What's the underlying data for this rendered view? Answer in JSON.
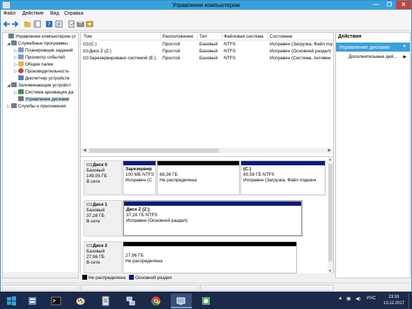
{
  "window": {
    "title": "Управление компьютером",
    "min_label": "—",
    "max_label": "❐",
    "close_label": "✕"
  },
  "menu": [
    "Файл",
    "Действие",
    "Вид",
    "Справка"
  ],
  "tree": [
    {
      "label": "Управление компьютером (л",
      "arrow": "",
      "icon_color": "#6d7c92",
      "selected": false
    },
    {
      "label": "Служебные программы",
      "arrow": "◢",
      "icon_color": "#6d7c92",
      "selected": false
    },
    {
      "label": "Планировщик заданий",
      "arrow": "▷",
      "icon_color": "#7a9bc4",
      "selected": false
    },
    {
      "label": "Просмотр событий",
      "arrow": "▷",
      "icon_color": "#7a9bc4",
      "selected": false
    },
    {
      "label": "Общие папки",
      "arrow": "▷",
      "icon_color": "#e3b84a",
      "selected": false
    },
    {
      "label": "Производительность",
      "arrow": "▷",
      "icon_color": "#c94040",
      "selected": false
    },
    {
      "label": "Диспетчер устройств",
      "arrow": "",
      "icon_color": "#5a7fb0",
      "selected": false
    },
    {
      "label": "Запоминающие устройст",
      "arrow": "◢",
      "icon_color": "#6d7c92",
      "selected": false
    },
    {
      "label": "Система архивации да",
      "arrow": "▷",
      "icon_color": "#3d8f4f",
      "selected": false
    },
    {
      "label": "Управление дисками",
      "arrow": "",
      "icon_color": "#777777",
      "selected": true
    },
    {
      "label": "Службы и приложения",
      "arrow": "▷",
      "icon_color": "#6d7c92",
      "selected": false
    }
  ],
  "volumes": {
    "headers": [
      "Том",
      "Расположение",
      "Тип",
      "Файловая система",
      "Состояние"
    ],
    "rows": [
      [
        "(C:)",
        "Простой",
        "Базовый",
        "NTFS",
        "Исправен (Загрузка, Файл подк"
      ],
      [
        "Диск Z (Z:)",
        "Простой",
        "Базовый",
        "NTFS",
        "Исправен (Основной раздел)"
      ],
      [
        "Зарезервировано системой (E:)",
        "Простой",
        "Базовый",
        "NTFS",
        "Исправен (Система, Активен"
      ]
    ]
  },
  "disks": [
    {
      "name": "Диск 0",
      "type": "Базовый",
      "size": "149,05 ГБ",
      "status": "В сети",
      "partitions": [
        {
          "title": "Зарезервир",
          "line1": "100 МБ NTFS",
          "line2": "Исправен (С",
          "kind": "primary"
        },
        {
          "title": "",
          "line1": "68,36 ГБ",
          "line2": "Не распределена",
          "kind": "unallocated"
        },
        {
          "title": "(C:)",
          "line1": "80,59 ГБ NTFS",
          "line2": "Исправен (Загрузка, Файл подкачк",
          "kind": "primary"
        }
      ]
    },
    {
      "name": "Диск 1",
      "type": "Базовый",
      "size": "37,28 ГБ",
      "status": "В сети",
      "partitions": [
        {
          "title": "Диск Z  (Z:)",
          "line1": "37,28 ГБ NTFS",
          "line2": "Исправен (Основной раздел)",
          "kind": "primary"
        }
      ]
    },
    {
      "name": "Диск 2",
      "type": "Базовый",
      "size": "27,96 ГБ",
      "status": "В сети",
      "partitions": [
        {
          "title": "",
          "line1": "27,96 ГБ",
          "line2": "Не распределена",
          "kind": "unallocated"
        }
      ]
    }
  ],
  "legend": {
    "unallocated": "Не распределена",
    "primary": "Основной раздел"
  },
  "actions": {
    "title": "Действия",
    "group": "Управление дисками",
    "item": "Дополнительные дей..."
  },
  "taskbar": {
    "lang": "РУС",
    "time": "23:33",
    "date": "13.12.2017"
  },
  "colors": {
    "titlebar": "#3aa0da",
    "primary_partition": "#0b1a7a",
    "unallocated": "#000000",
    "taskbar": "#1b2a4a"
  }
}
